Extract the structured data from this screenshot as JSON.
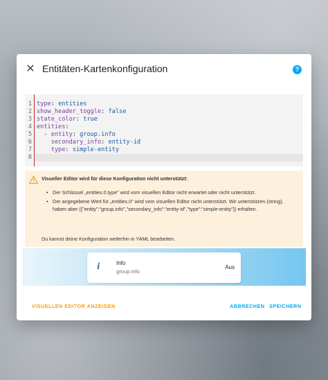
{
  "dialog": {
    "title": "Entitäten-Kartenkonfiguration",
    "close_icon": "close-icon",
    "help_icon": "help-circle-icon",
    "help_glyph": "?"
  },
  "yaml": {
    "lines": [
      {
        "num": "1",
        "parts": [
          {
            "t": "type",
            "c": "key"
          },
          {
            "t": ": ",
            "c": "plain"
          },
          {
            "t": "entities",
            "c": "val"
          }
        ]
      },
      {
        "num": "2",
        "parts": [
          {
            "t": "show_header_toggle",
            "c": "key"
          },
          {
            "t": ": ",
            "c": "plain"
          },
          {
            "t": "false",
            "c": "val"
          }
        ]
      },
      {
        "num": "3",
        "parts": [
          {
            "t": "state_color",
            "c": "key"
          },
          {
            "t": ": ",
            "c": "plain"
          },
          {
            "t": "true",
            "c": "val"
          }
        ]
      },
      {
        "num": "4",
        "parts": [
          {
            "t": "entities",
            "c": "key"
          },
          {
            "t": ":",
            "c": "plain"
          }
        ]
      },
      {
        "num": "5",
        "parts": [
          {
            "t": "  - ",
            "c": "plain"
          },
          {
            "t": "entity",
            "c": "key"
          },
          {
            "t": ": ",
            "c": "plain"
          },
          {
            "t": "group.info",
            "c": "val"
          }
        ]
      },
      {
        "num": "6",
        "parts": [
          {
            "t": "    ",
            "c": "plain"
          },
          {
            "t": "secondary_info",
            "c": "key"
          },
          {
            "t": ": ",
            "c": "plain"
          },
          {
            "t": "entity-id",
            "c": "val"
          }
        ]
      },
      {
        "num": "7",
        "parts": [
          {
            "t": "    ",
            "c": "plain"
          },
          {
            "t": "type",
            "c": "key"
          },
          {
            "t": ": ",
            "c": "plain"
          },
          {
            "t": "simple-entity",
            "c": "val"
          }
        ]
      },
      {
        "num": "8",
        "parts": []
      }
    ]
  },
  "warning": {
    "icon": "alert-triangle-icon",
    "title": "Visueller Editor wird für diese Konfiguration nicht unterstützt:",
    "items": [
      "Der Schlüssel „entities.0.type\" wird vom visuellen Editor nicht erwartet oder nicht unterstützt.",
      "Der angegebene Wert für „entities.0\" wird vom visuellen Editor nicht unterstützt. Wir unterstützen (string), haben aber ({\"entity\":\"group.info\",\"secondary_info\":\"entity-id\",\"type\":\"simple-entity\"}) erhalten."
    ],
    "footer": "Du kannst deine Konfiguration weiterhin in YAML bearbeiten."
  },
  "preview": {
    "icon": "info-icon",
    "icon_glyph": "i",
    "name": "Info",
    "secondary": "group.info",
    "state": "Aus"
  },
  "actions": {
    "show_visual": "VISUELLEN EDITOR ANZEIGEN",
    "cancel": "ABBRECHEN",
    "save": "SPEICHERN"
  },
  "colors": {
    "accent": "#03a9f4",
    "warning_bg": "#fdf1de",
    "warning_icon": "#f39c12",
    "yaml_key": "#7a3e9d",
    "yaml_value": "#1a5aa8",
    "gutter_error": "#c62828"
  }
}
